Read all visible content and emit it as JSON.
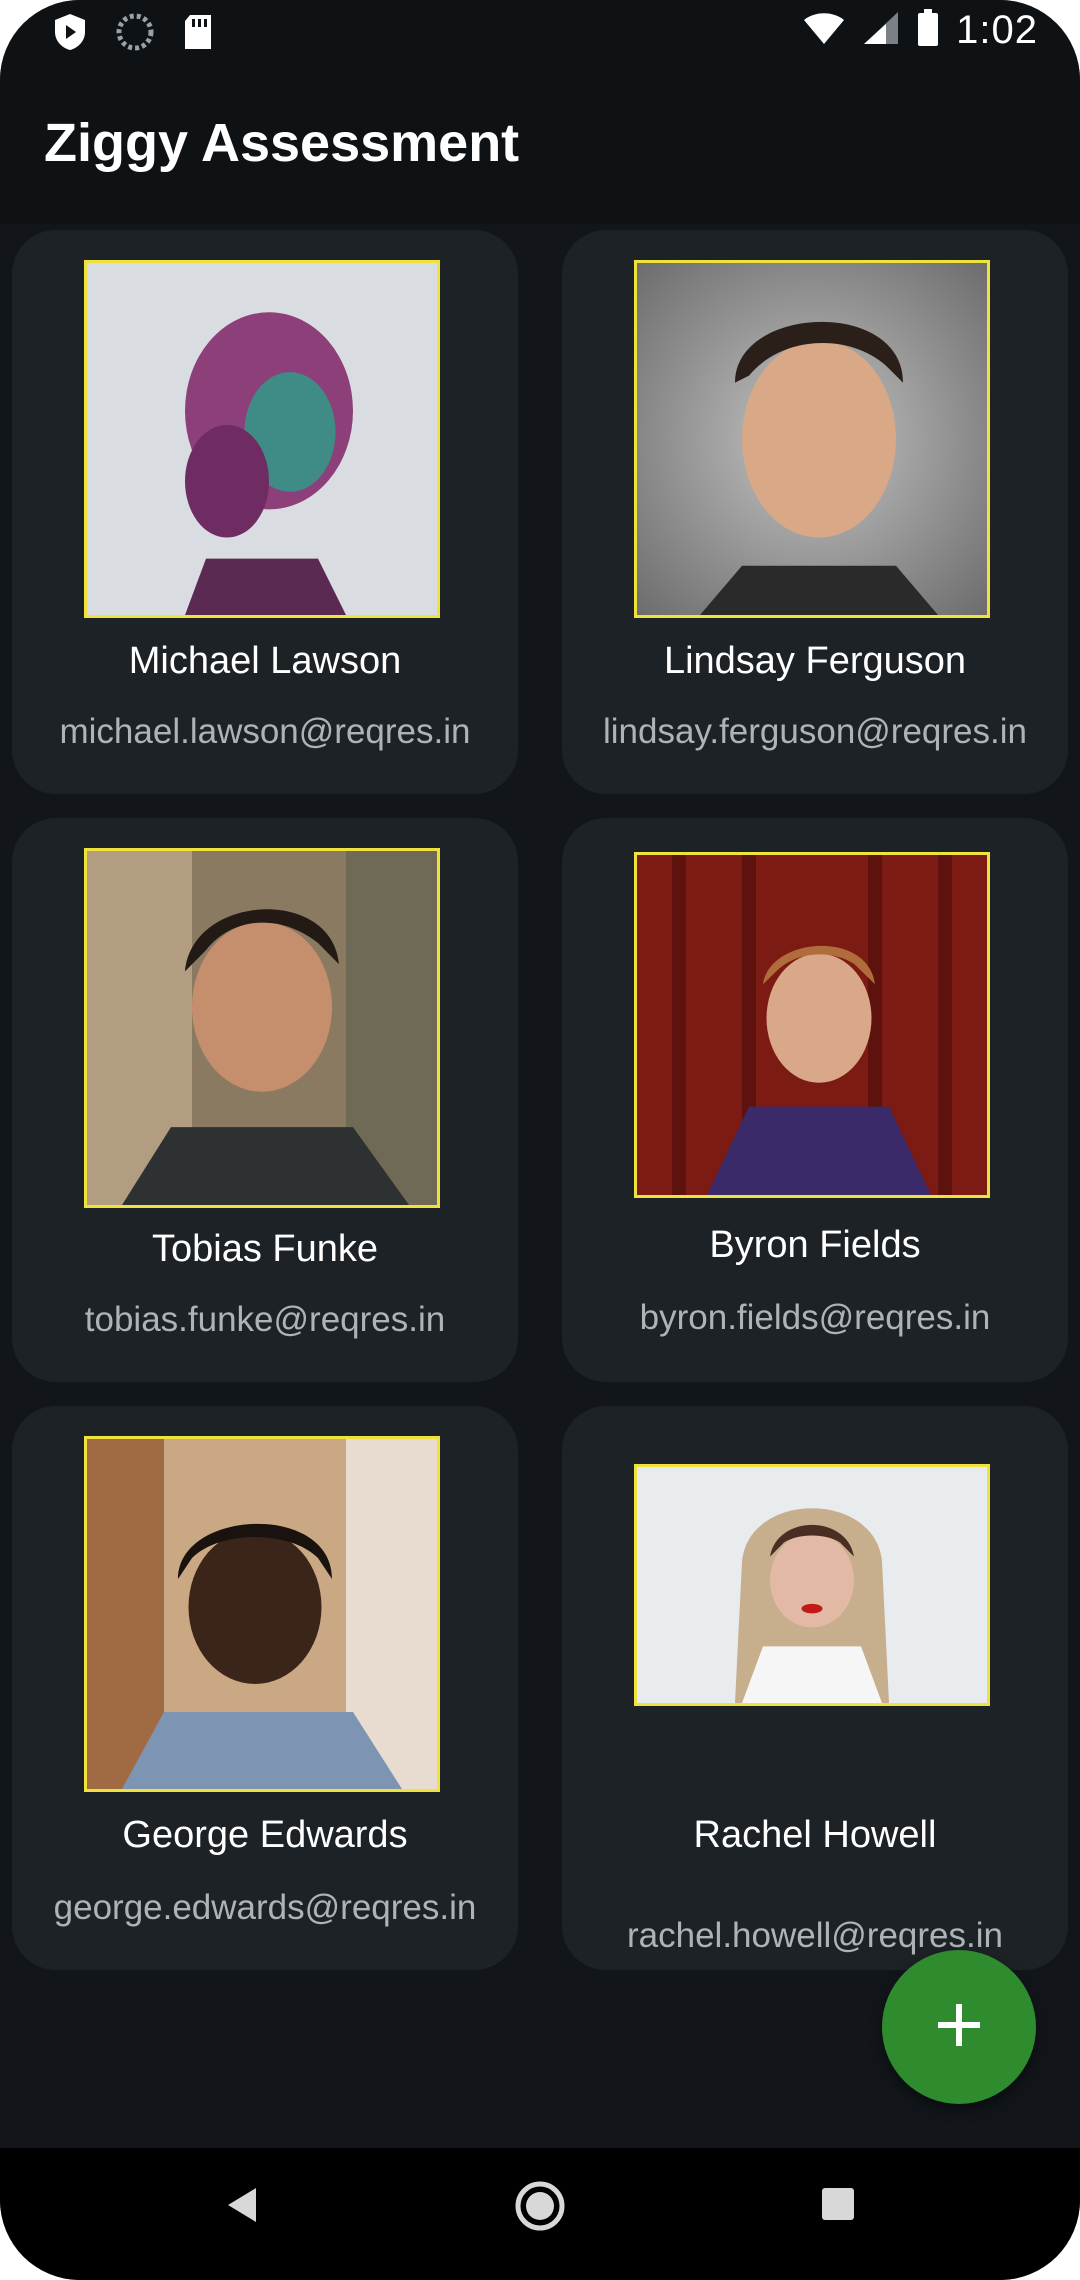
{
  "status_bar": {
    "time": "1:02",
    "icons": [
      "shield-play-icon",
      "spinner-icon",
      "sd-card-icon",
      "wifi-icon",
      "signal-icon",
      "battery-icon"
    ]
  },
  "app_bar": {
    "title": "Ziggy Assessment"
  },
  "users": [
    {
      "name": "Michael Lawson",
      "email": "michael.lawson@reqres.in",
      "avatar": "woman-profile-photo"
    },
    {
      "name": "Lindsay Ferguson",
      "email": "lindsay.ferguson@reqres.in",
      "avatar": "young-man-portrait-photo"
    },
    {
      "name": "Tobias Funke",
      "email": "tobias.funke@reqres.in",
      "avatar": "smiling-man-photo"
    },
    {
      "name": "Byron Fields",
      "email": "byron.fields@reqres.in",
      "avatar": "man-red-wall-photo"
    },
    {
      "name": "George Edwards",
      "email": "george.edwards@reqres.in",
      "avatar": "man-street-photo"
    },
    {
      "name": "Rachel Howell",
      "email": "rachel.howell@reqres.in",
      "avatar": "woman-snow-photo"
    }
  ],
  "fab": {
    "icon": "plus-icon",
    "color": "#2e8b2e"
  },
  "nav_bar": {
    "icons": [
      "back-icon",
      "home-icon",
      "recents-icon"
    ]
  },
  "colors": {
    "background": "#12161a",
    "card": "#1d2227",
    "photo_border": "#f0e23c",
    "email_text": "#aeb3b8"
  }
}
